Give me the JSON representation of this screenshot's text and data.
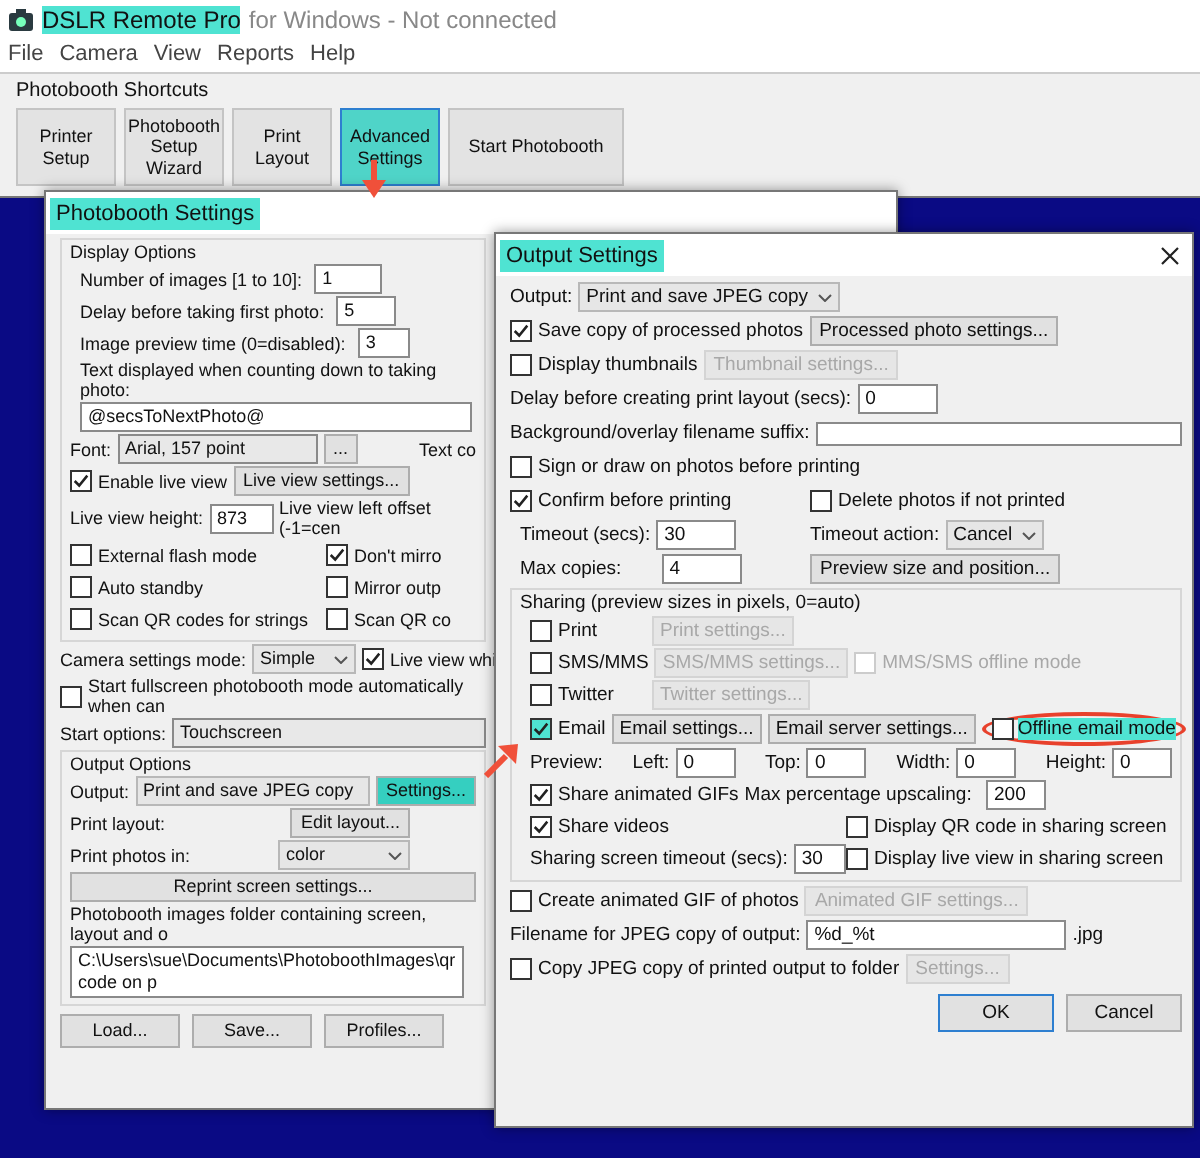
{
  "app": {
    "title": "DSLR Remote Pro",
    "title_highlighted": true,
    "subtitle": "for Windows - Not connected"
  },
  "menu": [
    "File",
    "Camera",
    "View",
    "Reports",
    "Help"
  ],
  "shortcuts": {
    "title": "Photobooth Shortcuts",
    "buttons": [
      {
        "label": "Printer Setup",
        "highlighted": false
      },
      {
        "label": "Photobooth Setup Wizard",
        "highlighted": false
      },
      {
        "label": "Print Layout",
        "highlighted": false
      },
      {
        "label": "Advanced Settings",
        "highlighted": true
      },
      {
        "label": "Start Photobooth",
        "highlighted": false
      }
    ]
  },
  "photobooth_settings": {
    "title": "Photobooth Settings",
    "title_highlighted": true,
    "display_options": {
      "title": "Display Options",
      "number_fields": [
        {
          "label": "Number of images [1 to 10]:",
          "value": "1"
        },
        {
          "label": "Delay before taking first photo:",
          "value": "5"
        },
        {
          "label": "Image preview time (0=disabled):",
          "value": "3"
        }
      ],
      "countdown_text": {
        "label": "Text displayed when counting down to taking photo:",
        "value": "@secsToNextPhoto@"
      },
      "font": {
        "label": "Font:",
        "value": "Arial, 157 point",
        "button": "...",
        "side_label": "Text co"
      },
      "enable_live_view": {
        "label": "Enable live view",
        "checked": true,
        "button": "Live view settings..."
      },
      "live_view_height": {
        "label": "Live view height:",
        "value": "873",
        "side_label": "Live view left offset (-1=cen"
      },
      "checks": [
        {
          "label": "External flash mode",
          "checked": false
        },
        {
          "label": "Don't mirro",
          "checked": true
        },
        {
          "label": "Auto standby",
          "checked": false
        },
        {
          "label": "Mirror outp",
          "checked": false
        },
        {
          "label": "Scan QR codes for strings",
          "checked": false
        },
        {
          "label": "Scan QR co",
          "checked": false
        }
      ]
    },
    "camera_settings_mode": {
      "label": "Camera settings mode:",
      "value": "Simple"
    },
    "live_view_while": {
      "label": "Live view whi",
      "checked": true
    },
    "fullscreen_start": {
      "label": "Start fullscreen photobooth mode automatically when can",
      "checked": false
    },
    "start_options": {
      "label": "Start options:",
      "value": "Touchscreen"
    },
    "output_options": {
      "title": "Output Options",
      "output": {
        "label": "Output:",
        "value": "Print and save JPEG copy",
        "button": "Settings...",
        "button_highlighted": true
      },
      "print_layout": {
        "label": "Print layout:",
        "button": "Edit layout..."
      },
      "print_photos_in": {
        "label": "Print photos in:",
        "value": "color"
      },
      "reprint_button": "Reprint screen settings...",
      "folder": {
        "label": "Photobooth images folder containing screen, layout and o",
        "value": "C:\\Users\\sue\\Documents\\PhotoboothImages\\qr code on p"
      }
    },
    "buttons": [
      "Load...",
      "Save...",
      "Profiles..."
    ]
  },
  "output_settings": {
    "title": "Output Settings",
    "title_highlighted": true,
    "output": {
      "label": "Output:",
      "value": "Print and save JPEG copy"
    },
    "options": [
      {
        "label": "Save copy of processed photos",
        "checked": true,
        "button": "Processed photo settings...",
        "button_disabled": false
      },
      {
        "label": "Display thumbnails",
        "checked": false,
        "button": "Thumbnail settings...",
        "button_disabled": true
      }
    ],
    "print_delay": {
      "label": "Delay before creating print layout (secs):",
      "value": "0"
    },
    "suffix": {
      "label": "Background/overlay filename suffix:"
    },
    "sign": {
      "label": "Sign or draw on photos before printing",
      "checked": false
    },
    "confirm": {
      "label": "Confirm before printing",
      "checked": true
    },
    "delete": {
      "label": "Delete photos if not printed",
      "checked": false
    },
    "timeout": {
      "label": "Timeout (secs):",
      "value": "30"
    },
    "timeout_action": {
      "label": "Timeout action:",
      "value": "Cancel"
    },
    "max_copies": {
      "label": "Max copies:",
      "value": "4"
    },
    "preview_button": "Preview size and position...",
    "sharing": {
      "title": "Sharing (preview sizes in pixels, 0=auto)",
      "channels": [
        {
          "label": "Print",
          "checked": false,
          "highlighted": false,
          "button": "Print settings...",
          "button_disabled": true
        },
        {
          "label": "SMS/MMS",
          "checked": false,
          "highlighted": false,
          "button": "SMS/MMS settings...",
          "button_disabled": true,
          "offline": {
            "label": "MMS/SMS offline mode",
            "checked": false,
            "disabled": true,
            "highlighted": false,
            "circled": false
          }
        },
        {
          "label": "Twitter",
          "checked": false,
          "highlighted": false,
          "button": "Twitter settings...",
          "button_disabled": true
        },
        {
          "label": "Email",
          "checked": true,
          "highlighted": true,
          "button": "Email settings...",
          "button_disabled": false,
          "server_button": "Email server settings...",
          "offline": {
            "label": "Offline email mode",
            "checked": false,
            "disabled": false,
            "highlighted": true,
            "circled": true
          }
        }
      ],
      "preview": {
        "label": "Preview:",
        "fields": [
          {
            "label": "Left:",
            "value": "0"
          },
          {
            "label": "Top:",
            "value": "0"
          },
          {
            "label": "Width:",
            "value": "0"
          },
          {
            "label": "Height:",
            "value": "0"
          }
        ]
      },
      "share_gifs": {
        "label": "Share animated GIFs",
        "checked": true
      },
      "max_upscaling": {
        "label": "Max percentage upscaling:",
        "value": "200"
      },
      "share_videos": {
        "label": "Share videos",
        "checked": true
      },
      "display_qr": {
        "label": "Display QR code in sharing screen",
        "checked": false
      },
      "display_live": {
        "label": "Display live view in sharing screen",
        "checked": false
      },
      "timeout": {
        "label": "Sharing screen timeout (secs):",
        "value": "30"
      }
    },
    "animated_gif": {
      "label": "Create animated GIF of photos",
      "checked": false,
      "button": "Animated GIF settings...",
      "button_disabled": true
    },
    "filename": {
      "label": "Filename for JPEG copy of output:",
      "value": "%d_%t",
      "extension": ".jpg"
    },
    "copy_to_folder": {
      "label": "Copy JPEG copy of printed output to folder",
      "checked": false,
      "button": "Settings...",
      "button_disabled": true
    },
    "buttons": [
      {
        "label": "OK",
        "default": true
      },
      {
        "label": "Cancel",
        "default": false
      }
    ]
  }
}
